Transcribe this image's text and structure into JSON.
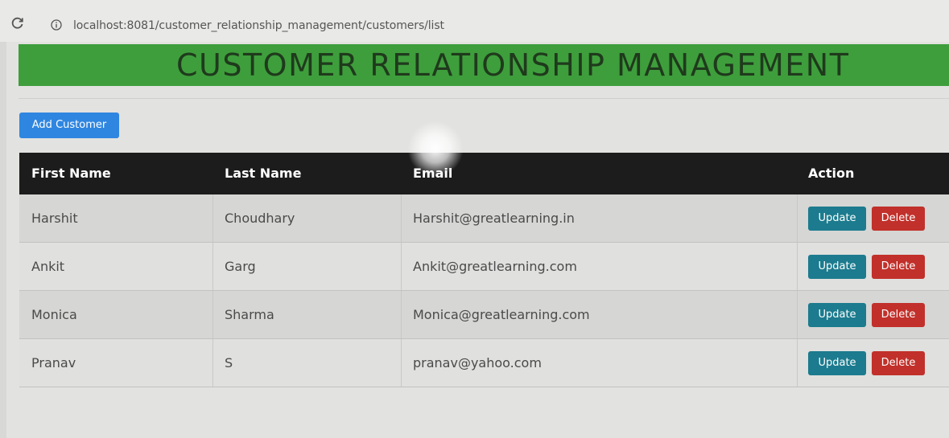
{
  "browser": {
    "url": "localhost:8081/customer_relationship_management/customers/list",
    "reload_icon": "reload-icon",
    "info_icon": "info-icon"
  },
  "header": {
    "title": "CUSTOMER RELATIONSHIP MANAGEMENT",
    "banner_color": "#3e9e3c"
  },
  "actions": {
    "add_label": "Add Customer",
    "add_color": "#2f86e0"
  },
  "table": {
    "columns": [
      "First Name",
      "Last Name",
      "Email",
      "Action"
    ],
    "rows": [
      {
        "first": "Harshit",
        "last": "Choudhary",
        "email": "Harshit@greatlearning.in"
      },
      {
        "first": "Ankit",
        "last": "Garg",
        "email": "Ankit@greatlearning.com"
      },
      {
        "first": "Monica",
        "last": "Sharma",
        "email": "Monica@greatlearning.com"
      },
      {
        "first": "Pranav",
        "last": "S",
        "email": "pranav@yahoo.com"
      }
    ],
    "update_label": "Update",
    "delete_label": "Delete",
    "update_color": "#1c7b8e",
    "delete_color": "#c1302a"
  }
}
